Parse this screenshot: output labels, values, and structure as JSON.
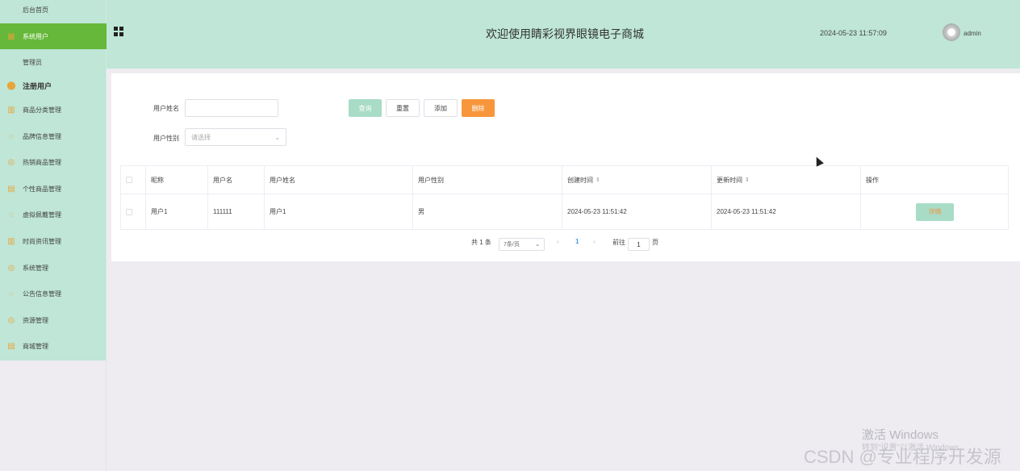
{
  "sidebar": {
    "items": [
      {
        "label": "后台首页",
        "icon": "none"
      },
      {
        "label": "系统用户",
        "icon": "grid-icon",
        "active": true
      },
      {
        "label": "管理员",
        "icon": "none"
      },
      {
        "label": "注册用户",
        "icon": "location-icon",
        "bold": true
      },
      {
        "label": "商品分类管理",
        "icon": "bar-chart-icon"
      },
      {
        "label": "品牌信息管理",
        "icon": "chat-icon"
      },
      {
        "label": "热销商品管理",
        "icon": "check-circle-icon"
      },
      {
        "label": "个性商品管理",
        "icon": "document-icon"
      },
      {
        "label": "虚拟佩戴管理",
        "icon": "chat-icon"
      },
      {
        "label": "时尚资讯管理",
        "icon": "bar-chart-icon"
      },
      {
        "label": "系统管理",
        "icon": "check-circle-icon"
      },
      {
        "label": "公告信息管理",
        "icon": "chat-icon"
      },
      {
        "label": "资源管理",
        "icon": "check-circle-icon"
      },
      {
        "label": "商城管理",
        "icon": "document-icon"
      }
    ]
  },
  "header": {
    "title": "欢迎使用睛彩视界眼镜电子商城",
    "time": "2024-05-23 11:57:09",
    "username": "admin"
  },
  "search": {
    "name_label": "用户姓名",
    "name_value": "",
    "gender_label": "用户性别",
    "gender_placeholder": "请选择",
    "query_label": "查询",
    "reset_label": "重置",
    "add_label": "添加",
    "delete_label": "删除"
  },
  "table": {
    "columns": [
      "昵称",
      "用户名",
      "用户姓名",
      "用户性别",
      "创建时间",
      "更新时间",
      "操作"
    ],
    "rows": [
      {
        "nickname": "用户1",
        "username": "111111",
        "realname": "用户1",
        "gender": "男",
        "created": "2024-05-23 11:51:42",
        "updated": "2024-05-23 11:51:42",
        "action": "详情"
      }
    ]
  },
  "pagination": {
    "total": "共 1 条",
    "page_size": "7条/页",
    "current": "1",
    "goto_label": "前往",
    "goto_value": "1",
    "page_suffix": "页"
  },
  "watermark": {
    "activate": "激活 Windows",
    "activate_sub": "转到\"设置\"以激活 Windows。",
    "csdn": "CSDN @专业程序开发源"
  },
  "colors": {
    "sidebar_bg": "#bfe6d6",
    "active_item": "#65b83a",
    "accent_orange": "#f7963a",
    "query_btn": "#a8dcc6"
  }
}
